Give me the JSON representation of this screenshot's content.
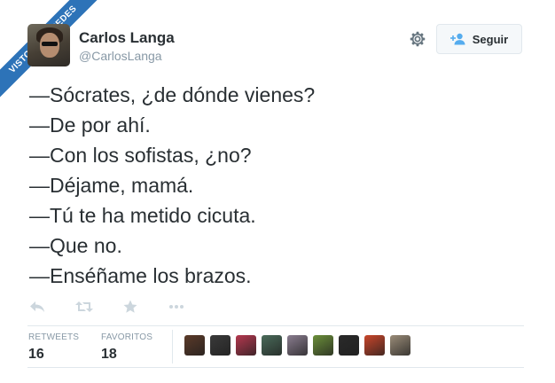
{
  "watermark": "VISTOENLASREDES",
  "author": {
    "name": "Carlos Langa",
    "handle": "@CarlosLanga"
  },
  "header": {
    "gear_icon": "gear-icon",
    "follow_label": "Seguir",
    "follow_icon": "add-user-icon"
  },
  "tweet": {
    "lines": [
      "—Sócrates, ¿de dónde vienes?",
      "—De por ahí.",
      "—Con los sofistas, ¿no?",
      "—Déjame, mamá.",
      "—Tú te ha metido cicuta.",
      "—Que no.",
      "—Enséñame los brazos."
    ]
  },
  "actions": [
    "reply-icon",
    "retweet-icon",
    "favorite-icon",
    "more-icon"
  ],
  "stats": {
    "retweets_label": "RETWEETS",
    "retweets_count": "16",
    "favorites_label": "FAVORITOS",
    "favorites_count": "18"
  },
  "favoriters": [
    {
      "name": "favoriter-avatar",
      "color": "#5b3a29"
    },
    {
      "name": "favoriter-avatar",
      "color": "#3a3a3a"
    },
    {
      "name": "favoriter-avatar",
      "color": "#b5384f"
    },
    {
      "name": "favoriter-avatar",
      "color": "#4a6b5a"
    },
    {
      "name": "favoriter-avatar",
      "color": "#8a7d8f"
    },
    {
      "name": "favoriter-avatar",
      "color": "#6b8f3a"
    },
    {
      "name": "favoriter-avatar",
      "color": "#2a2a2a"
    },
    {
      "name": "favoriter-avatar",
      "color": "#c9462b"
    },
    {
      "name": "favoriter-avatar",
      "color": "#9a8c78"
    }
  ],
  "colors": {
    "ribbon": "#2d73b8",
    "text": "#292f33",
    "muted": "#8899a6",
    "follow_icon": "#55acee",
    "action_icon": "#ccd6dd"
  }
}
